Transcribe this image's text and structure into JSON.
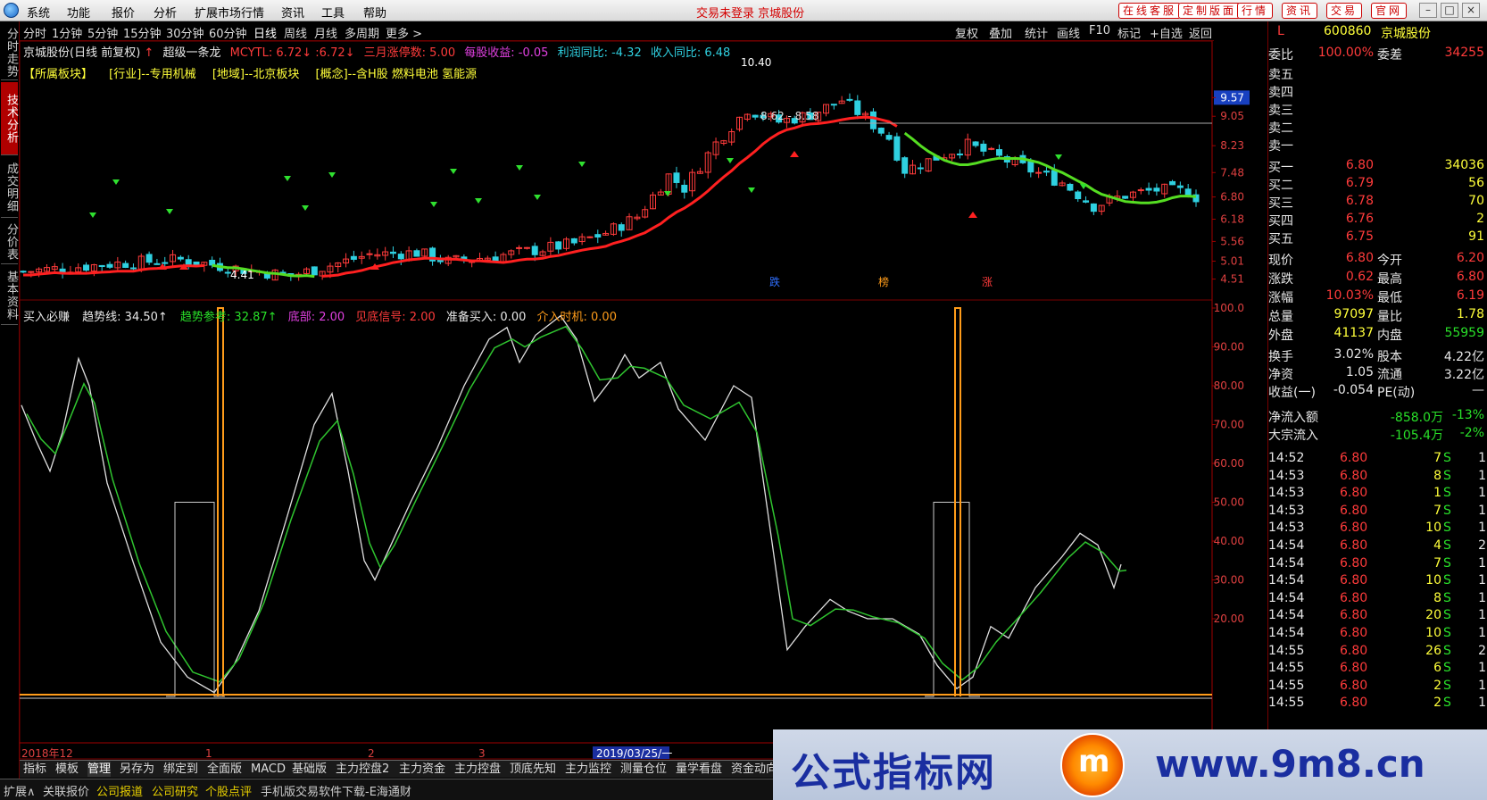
{
  "menu": {
    "items": [
      "系统",
      "功能",
      "报价",
      "分析",
      "扩展市场行情",
      "资讯",
      "工具",
      "帮助"
    ],
    "center_status": "交易未登录  京城股份",
    "right_buttons": [
      "在线客服",
      "定制版面",
      "行情",
      "资讯",
      "交易",
      "官网"
    ]
  },
  "side_tabs": [
    "分时走势",
    "技术分析",
    "成交明细",
    "分价表",
    "基本资料"
  ],
  "periods": [
    "分时",
    "1分钟",
    "5分钟",
    "15分钟",
    "30分钟",
    "60分钟",
    "日线",
    "周线",
    "月线",
    "多周期",
    "更多 >"
  ],
  "active_period": "日线",
  "tools": [
    "复权",
    "叠加",
    "统计",
    "画线",
    "F10",
    "标记",
    "+自选",
    "返回"
  ],
  "main_header": {
    "name": "京城股份(日线 前复权)",
    "indicator": "超级一条龙",
    "mcytl": "MCYTL: 6.72↓ :6.72↓",
    "zt": "三月涨停数: 5.00",
    "eps": "每股收益: -0.05",
    "profit": "利润同比: -4.32",
    "income": "收入同比: 6.48"
  },
  "sector_line": {
    "label": "【所属板块】",
    "industry": "[行业]--专用机械",
    "region": "[地域]--北京板块",
    "concept": "[概念]--含H股 燃料电池 氢能源"
  },
  "price_axis": [
    "9.57",
    "9.05",
    "8.23",
    "7.48",
    "6.80",
    "6.18",
    "5.56",
    "5.01",
    "4.51"
  ],
  "chart_annotations": {
    "high": "10.40",
    "low": "4.41",
    "range": "8.62 - 8.58",
    "flags": [
      "跌",
      "榜",
      "涨"
    ]
  },
  "sub_header": {
    "name": "买入必赚",
    "trend": "趋势线: 34.50↑",
    "ref": "趋势参考: 32.87↑",
    "bottom": "底部: 2.00",
    "signal": "见底信号: 2.00",
    "prep": "准备买入: 0.00",
    "timing": "介入时机: 0.00"
  },
  "sub_axis": [
    "100.0",
    "90.00",
    "80.00",
    "70.00",
    "60.00",
    "50.00",
    "40.00",
    "30.00",
    "20.00"
  ],
  "date_axis": [
    "2018年12",
    "1",
    "2",
    "3",
    "2019/03/25/一"
  ],
  "bottom_tabs": [
    "指标",
    "模板",
    "管理",
    "另存为",
    "绑定到",
    "全面版",
    "MACD",
    "基础版",
    "主力控盘2",
    "主力资金",
    "主力控盘",
    "顶底先知",
    "主力监控",
    "测量仓位",
    "量学看盘",
    "资金动向"
  ],
  "status_bar": [
    "扩展∧",
    "关联报价",
    "公司报道",
    "公司研究",
    "个股点评",
    "手机版交易软件下载-E海通财"
  ],
  "quote": {
    "marker": "L",
    "code": "600860",
    "name": "京城股份",
    "weibi_label": "委比",
    "weibi": "100.00%",
    "weicha_label": "委差",
    "weicha": "34255",
    "sell": [
      {
        "label": "卖五"
      },
      {
        "label": "卖四"
      },
      {
        "label": "卖三"
      },
      {
        "label": "卖二"
      },
      {
        "label": "卖一"
      }
    ],
    "buy": [
      {
        "label": "买一",
        "price": "6.80",
        "vol": "34036"
      },
      {
        "label": "买二",
        "price": "6.79",
        "vol": "56"
      },
      {
        "label": "买三",
        "price": "6.78",
        "vol": "70"
      },
      {
        "label": "买四",
        "price": "6.76",
        "vol": "2"
      },
      {
        "label": "买五",
        "price": "6.75",
        "vol": "91"
      }
    ],
    "stats": [
      {
        "l1": "现价",
        "v1": "6.80",
        "l2": "今开",
        "v2": "6.20"
      },
      {
        "l1": "涨跌",
        "v1": "0.62",
        "l2": "最高",
        "v2": "6.80"
      },
      {
        "l1": "涨幅",
        "v1": "10.03%",
        "l2": "最低",
        "v2": "6.19"
      },
      {
        "l1": "总量",
        "v1": "97097",
        "l2": "量比",
        "v2": "1.78"
      },
      {
        "l1": "外盘",
        "v1": "41137",
        "l2": "内盘",
        "v2": "55959"
      }
    ],
    "stats2": [
      {
        "l1": "换手",
        "v1": "3.02%",
        "l2": "股本",
        "v2": "4.22亿"
      },
      {
        "l1": "净资",
        "v1": "1.05",
        "l2": "流通",
        "v2": "3.22亿"
      },
      {
        "l1": "收益(一)",
        "v1": "-0.054",
        "l2": "PE(动)",
        "v2": "—"
      }
    ],
    "flow": [
      {
        "label": "净流入额",
        "value": "-858.0万",
        "pct": "-13%"
      },
      {
        "label": "大宗流入",
        "value": "-105.4万",
        "pct": "-2%"
      }
    ],
    "ticks": [
      {
        "t": "14:52",
        "p": "6.80",
        "v": "7",
        "s": "S",
        "n": "1"
      },
      {
        "t": "14:53",
        "p": "6.80",
        "v": "8",
        "s": "S",
        "n": "1"
      },
      {
        "t": "14:53",
        "p": "6.80",
        "v": "1",
        "s": "S",
        "n": "1"
      },
      {
        "t": "14:53",
        "p": "6.80",
        "v": "7",
        "s": "S",
        "n": "1"
      },
      {
        "t": "14:53",
        "p": "6.80",
        "v": "10",
        "s": "S",
        "n": "1"
      },
      {
        "t": "14:54",
        "p": "6.80",
        "v": "4",
        "s": "S",
        "n": "2"
      },
      {
        "t": "14:54",
        "p": "6.80",
        "v": "7",
        "s": "S",
        "n": "1"
      },
      {
        "t": "14:54",
        "p": "6.80",
        "v": "10",
        "s": "S",
        "n": "1"
      },
      {
        "t": "14:54",
        "p": "6.80",
        "v": "8",
        "s": "S",
        "n": "1"
      },
      {
        "t": "14:54",
        "p": "6.80",
        "v": "20",
        "s": "S",
        "n": "1"
      },
      {
        "t": "14:54",
        "p": "6.80",
        "v": "10",
        "s": "S",
        "n": "1"
      },
      {
        "t": "14:55",
        "p": "6.80",
        "v": "26",
        "s": "S",
        "n": "2"
      },
      {
        "t": "14:55",
        "p": "6.80",
        "v": "6",
        "s": "S",
        "n": "1"
      },
      {
        "t": "14:55",
        "p": "6.80",
        "v": "2",
        "s": "S",
        "n": "1"
      },
      {
        "t": "14:55",
        "p": "6.80",
        "v": "2",
        "s": "S",
        "n": "1"
      }
    ]
  },
  "banner": {
    "cn": "公式指标网",
    "url": "www.9m8.cn"
  },
  "colors": {
    "up": "#ff3b3b",
    "down": "#2fd0e0",
    "ma_red": "#ff2020",
    "ma_green": "#55dd22",
    "trend_white": "#e0e0e0",
    "trend_green": "#2fc42f",
    "signal": "#ff9c1a"
  }
}
